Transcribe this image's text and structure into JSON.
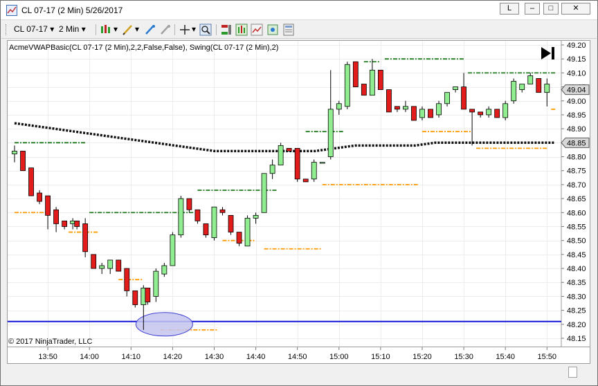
{
  "window": {
    "title": "CL 07-17 (2 Min)  5/26/2017",
    "btn_l": "L",
    "btn_min": "–",
    "btn_max": "□",
    "btn_close": "✕"
  },
  "toolbar": {
    "instrument": "CL 07-17",
    "interval": "2 Min",
    "icons": [
      "bar-type-icon",
      "drawing-tool-icon",
      "stop-drawing-icon",
      "crosshair-icon",
      "zoom-icon",
      "chart-trader-icon",
      "indicators-icon",
      "strategies-icon",
      "snapshot-icon",
      "properties-icon"
    ]
  },
  "chart": {
    "indicator_label": "AcmeVWAPBasic(CL 07-17 (2 Min),2,2,False,False), Swing(CL 07-17 (2 Min),2)",
    "copyright": "© 2017 NinjaTrader, LLC",
    "last_price_label": "49.04",
    "vwap_label": "48.85",
    "colors": {
      "up": "#90ee90",
      "down": "#e21b1b",
      "swing_high": "#1f7a1f",
      "swing_low": "#ff9900",
      "vwap": "#111111",
      "hline": "#1414d8",
      "ellipse_fill": "#c4c4f0",
      "ellipse_stroke": "#3a3ad0"
    }
  },
  "chart_data": {
    "type": "candlestick",
    "ylim": [
      48.15,
      49.2
    ],
    "yticks": [
      "49.20",
      "49.15",
      "49.10",
      "49.05",
      "49.00",
      "48.95",
      "48.90",
      "48.85",
      "48.80",
      "48.75",
      "48.70",
      "48.65",
      "48.60",
      "48.55",
      "48.50",
      "48.45",
      "48.40",
      "48.35",
      "48.30",
      "48.25",
      "48.20",
      "48.15"
    ],
    "xticks": [
      "13:50",
      "14:00",
      "14:10",
      "14:20",
      "14:30",
      "14:40",
      "14:50",
      "15:00",
      "15:10",
      "15:20",
      "15:30",
      "15:40",
      "15:50"
    ],
    "xtick_bars": [
      8,
      18,
      28,
      38,
      48,
      58,
      68,
      78,
      88,
      98,
      108,
      118,
      128
    ],
    "candles": [
      {
        "o": 48.81,
        "h": 48.84,
        "l": 48.78,
        "c": 48.82
      },
      {
        "o": 48.82,
        "h": 48.82,
        "l": 48.75,
        "c": 48.75
      },
      {
        "o": 48.76,
        "h": 48.76,
        "l": 48.66,
        "c": 48.66
      },
      {
        "o": 48.67,
        "h": 48.68,
        "l": 48.63,
        "c": 48.64
      },
      {
        "o": 48.66,
        "h": 48.66,
        "l": 48.54,
        "c": 48.59
      },
      {
        "o": 48.61,
        "h": 48.62,
        "l": 48.53,
        "c": 48.56
      },
      {
        "o": 48.57,
        "h": 48.57,
        "l": 48.54,
        "c": 48.55
      },
      {
        "o": 48.56,
        "h": 48.58,
        "l": 48.54,
        "c": 48.57
      },
      {
        "o": 48.57,
        "h": 48.57,
        "l": 48.54,
        "c": 48.55
      },
      {
        "o": 48.56,
        "h": 48.58,
        "l": 48.44,
        "c": 48.46
      },
      {
        "o": 48.45,
        "h": 48.45,
        "l": 48.4,
        "c": 48.4
      },
      {
        "o": 48.4,
        "h": 48.42,
        "l": 48.38,
        "c": 48.41
      },
      {
        "o": 48.4,
        "h": 48.43,
        "l": 48.38,
        "c": 48.43
      },
      {
        "o": 48.43,
        "h": 48.43,
        "l": 48.39,
        "c": 48.39
      },
      {
        "o": 48.4,
        "h": 48.4,
        "l": 48.3,
        "c": 48.32
      },
      {
        "o": 48.32,
        "h": 48.32,
        "l": 48.26,
        "c": 48.27
      },
      {
        "o": 48.27,
        "h": 48.34,
        "l": 48.18,
        "c": 48.33
      },
      {
        "o": 48.33,
        "h": 48.33,
        "l": 48.27,
        "c": 48.28
      },
      {
        "o": 48.3,
        "h": 48.4,
        "l": 48.28,
        "c": 48.39
      },
      {
        "o": 48.38,
        "h": 48.42,
        "l": 48.37,
        "c": 48.41
      },
      {
        "o": 48.41,
        "h": 48.53,
        "l": 48.41,
        "c": 48.52
      },
      {
        "o": 48.52,
        "h": 48.66,
        "l": 48.51,
        "c": 48.65
      },
      {
        "o": 48.65,
        "h": 48.65,
        "l": 48.6,
        "c": 48.61
      },
      {
        "o": 48.61,
        "h": 48.61,
        "l": 48.56,
        "c": 48.57
      },
      {
        "o": 48.56,
        "h": 48.56,
        "l": 48.51,
        "c": 48.52
      },
      {
        "o": 48.51,
        "h": 48.62,
        "l": 48.5,
        "c": 48.62
      },
      {
        "o": 48.61,
        "h": 48.62,
        "l": 48.59,
        "c": 48.6
      },
      {
        "o": 48.59,
        "h": 48.59,
        "l": 48.52,
        "c": 48.53
      },
      {
        "o": 48.53,
        "h": 48.53,
        "l": 48.48,
        "c": 48.49
      },
      {
        "o": 48.48,
        "h": 48.59,
        "l": 48.48,
        "c": 48.58
      },
      {
        "o": 48.58,
        "h": 48.6,
        "l": 48.56,
        "c": 48.59
      },
      {
        "o": 48.6,
        "h": 48.74,
        "l": 48.6,
        "c": 48.74
      },
      {
        "o": 48.74,
        "h": 48.79,
        "l": 48.72,
        "c": 48.77
      },
      {
        "o": 48.77,
        "h": 48.85,
        "l": 48.77,
        "c": 48.84
      },
      {
        "o": 48.83,
        "h": 48.83,
        "l": 48.82,
        "c": 48.82
      },
      {
        "o": 48.83,
        "h": 48.83,
        "l": 48.71,
        "c": 48.72
      },
      {
        "o": 48.72,
        "h": 48.72,
        "l": 48.71,
        "c": 48.71
      },
      {
        "o": 48.72,
        "h": 48.79,
        "l": 48.71,
        "c": 48.78
      },
      {
        "o": 48.78,
        "h": 48.78,
        "l": 48.78,
        "c": 48.78
      },
      {
        "o": 48.8,
        "h": 49.11,
        "l": 48.79,
        "c": 48.97
      },
      {
        "o": 48.97,
        "h": 49.0,
        "l": 48.95,
        "c": 48.99
      },
      {
        "o": 48.98,
        "h": 49.14,
        "l": 48.97,
        "c": 49.13
      },
      {
        "o": 49.14,
        "h": 49.14,
        "l": 49.05,
        "c": 49.05
      },
      {
        "o": 49.06,
        "h": 49.06,
        "l": 49.02,
        "c": 49.02
      },
      {
        "o": 49.02,
        "h": 49.15,
        "l": 49.02,
        "c": 49.11
      },
      {
        "o": 49.11,
        "h": 49.11,
        "l": 49.04,
        "c": 49.04
      },
      {
        "o": 49.04,
        "h": 49.04,
        "l": 48.96,
        "c": 48.96
      },
      {
        "o": 48.98,
        "h": 48.98,
        "l": 48.96,
        "c": 48.97
      },
      {
        "o": 48.97,
        "h": 49.0,
        "l": 48.96,
        "c": 48.98
      },
      {
        "o": 48.98,
        "h": 48.98,
        "l": 48.93,
        "c": 48.93
      },
      {
        "o": 48.94,
        "h": 48.98,
        "l": 48.93,
        "c": 48.97
      },
      {
        "o": 48.97,
        "h": 48.97,
        "l": 48.94,
        "c": 48.94
      },
      {
        "o": 48.95,
        "h": 49.0,
        "l": 48.94,
        "c": 48.99
      },
      {
        "o": 48.99,
        "h": 49.03,
        "l": 48.98,
        "c": 49.03
      },
      {
        "o": 49.04,
        "h": 49.05,
        "l": 49.03,
        "c": 49.05
      },
      {
        "o": 49.05,
        "h": 49.1,
        "l": 48.97,
        "c": 48.97
      },
      {
        "o": 48.97,
        "h": 48.97,
        "l": 48.84,
        "c": 48.96
      },
      {
        "o": 48.96,
        "h": 48.96,
        "l": 48.94,
        "c": 48.95
      },
      {
        "o": 48.95,
        "h": 48.98,
        "l": 48.94,
        "c": 48.97
      },
      {
        "o": 48.97,
        "h": 48.97,
        "l": 48.94,
        "c": 48.94
      },
      {
        "o": 48.94,
        "h": 49.0,
        "l": 48.93,
        "c": 48.99
      },
      {
        "o": 49.0,
        "h": 49.08,
        "l": 48.99,
        "c": 49.07
      },
      {
        "o": 49.04,
        "h": 49.06,
        "l": 49.03,
        "c": 49.06
      },
      {
        "o": 49.06,
        "h": 49.1,
        "l": 49.06,
        "c": 49.09
      },
      {
        "o": 49.08,
        "h": 49.08,
        "l": 49.03,
        "c": 49.03
      },
      {
        "o": 49.03,
        "h": 49.08,
        "l": 48.98,
        "c": 49.06
      }
    ],
    "candle_bars": [
      0,
      2,
      4,
      6,
      8,
      10,
      12,
      14,
      15,
      17,
      19,
      21,
      23,
      25,
      27,
      29,
      31,
      32,
      34,
      36,
      38,
      40,
      42,
      44,
      46,
      48,
      50,
      52,
      54,
      56,
      58,
      60,
      62,
      64,
      66,
      68,
      70,
      72,
      74,
      76,
      78,
      80,
      82,
      84,
      86,
      88,
      90,
      92,
      94,
      96,
      98,
      100,
      102,
      104,
      106,
      108,
      110,
      112,
      114,
      116,
      118,
      120,
      122,
      124,
      126,
      128
    ],
    "vwap": {
      "start_bar": 0,
      "end_bar": 130,
      "values": [
        48.92,
        48.91,
        48.9,
        48.89,
        48.88,
        48.87,
        48.86,
        48.85,
        48.84,
        48.83,
        48.82,
        48.82,
        48.82,
        48.82,
        48.82,
        48.82,
        48.83,
        48.84,
        48.84,
        48.84,
        48.84,
        48.85,
        48.85,
        48.85,
        48.85,
        48.85,
        48.85,
        48.85
      ]
    },
    "swing_highs": [
      {
        "value": 48.85,
        "from": 0,
        "to": 17
      },
      {
        "value": 48.6,
        "from": 18,
        "to": 43
      },
      {
        "value": 48.68,
        "from": 44,
        "to": 63
      },
      {
        "value": 48.89,
        "from": 70,
        "to": 79
      },
      {
        "value": 49.14,
        "from": 84,
        "to": 88
      },
      {
        "value": 49.15,
        "from": 89,
        "to": 108
      },
      {
        "value": 49.1,
        "from": 109,
        "to": 130
      }
    ],
    "swing_lows": [
      {
        "value": 48.6,
        "from": 0,
        "to": 8
      },
      {
        "value": 48.53,
        "from": 13,
        "to": 20
      },
      {
        "value": 48.36,
        "from": 25,
        "to": 31
      },
      {
        "value": 48.18,
        "from": 35,
        "to": 49
      },
      {
        "value": 48.5,
        "from": 50,
        "to": 58
      },
      {
        "value": 48.47,
        "from": 60,
        "to": 74
      },
      {
        "value": 48.7,
        "from": 74,
        "to": 97
      },
      {
        "value": 48.89,
        "from": 98,
        "to": 110
      },
      {
        "value": 48.83,
        "from": 111,
        "to": 128
      },
      {
        "value": 48.97,
        "from": 129,
        "to": 130
      }
    ],
    "horizontal_line": 48.21,
    "ellipse": {
      "bar": 36,
      "price": 48.2
    }
  }
}
